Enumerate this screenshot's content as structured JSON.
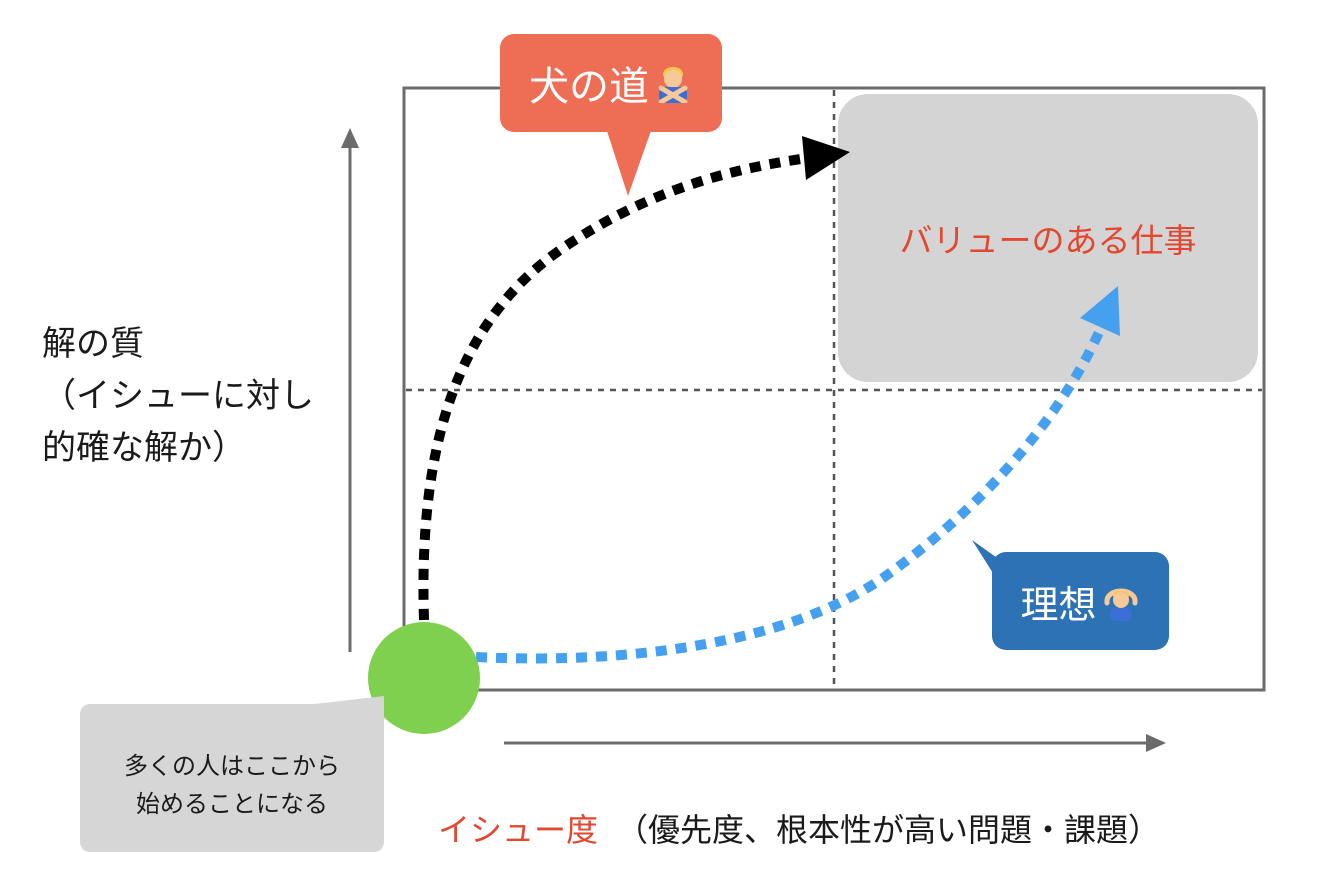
{
  "y_axis": {
    "title_lines": [
      "解の質",
      "（イシューに対し",
      "的確な解か）"
    ]
  },
  "x_axis": {
    "title_accent": "イシュー度",
    "title_rest": "（優先度、根本性が高い問題・課題）"
  },
  "quadrant_value_label": "バリューのある仕事",
  "callouts": {
    "dog_path": {
      "label": "犬の道",
      "icon": "person-gesturing-no-icon",
      "color": "#ee6d55"
    },
    "ideal": {
      "label": "理想",
      "icon": "person-gesturing-ok-icon",
      "color": "#2d72b5"
    },
    "start": {
      "lines": [
        "多くの人はここから",
        "始めることになる"
      ],
      "color": "#d6d6d6"
    }
  },
  "colors": {
    "frame": "#6b6b6b",
    "value_box": "#d4d4d4",
    "dog_path": "#000000",
    "ideal_path": "#46a0f0",
    "start_point": "#7ed04e",
    "accent_text": "#e2472f"
  }
}
